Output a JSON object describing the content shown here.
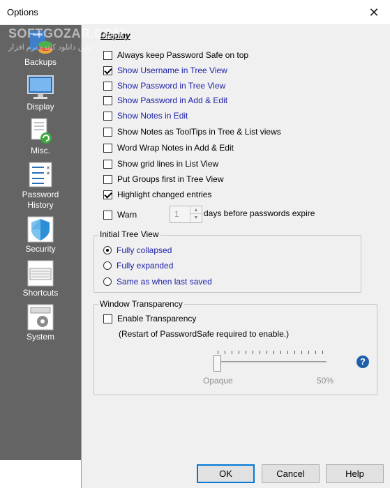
{
  "window": {
    "title": "Options",
    "close_glyph": "✕"
  },
  "watermark": {
    "line1": "SOFTGOZAR.COM",
    "line2": "اولین دانلود کننده نرم افزار"
  },
  "sidebar": {
    "items": [
      {
        "label": "Backups",
        "icon": "backups-icon"
      },
      {
        "label": "Display",
        "icon": "monitor-icon"
      },
      {
        "label": "Misc.",
        "icon": "misc-icon"
      },
      {
        "label": "Password\nHistory",
        "line1": "Password",
        "line2": "History",
        "icon": "password-history-icon"
      },
      {
        "label": "Security",
        "icon": "shield-icon"
      },
      {
        "label": "Shortcuts",
        "icon": "keyboard-icon"
      },
      {
        "label": "System",
        "icon": "system-icon"
      }
    ]
  },
  "display": {
    "section_title": "Display",
    "options": [
      {
        "label": "Always keep Password Safe on top",
        "checked": false
      },
      {
        "label": "Show Username in Tree View",
        "checked": true
      },
      {
        "label": "Show Password in Tree View",
        "checked": false
      },
      {
        "label": "Show Password in Add & Edit",
        "checked": false
      },
      {
        "label": "Show Notes in Edit",
        "checked": false
      },
      {
        "label": "Show Notes as ToolTips in Tree & List views",
        "checked": false
      },
      {
        "label": "Word Wrap Notes in Add & Edit",
        "checked": false
      },
      {
        "label": "Show grid lines in List View",
        "checked": false
      },
      {
        "label": "Put Groups first in Tree View",
        "checked": false
      },
      {
        "label": "Highlight changed entries",
        "checked": true
      }
    ],
    "warn": {
      "label": "Warn",
      "checked": false,
      "value": "1",
      "suffix": "days before passwords expire"
    }
  },
  "initial_tree_view": {
    "title": "Initial Tree View",
    "options": [
      {
        "label": "Fully collapsed",
        "selected": true
      },
      {
        "label": "Fully expanded",
        "selected": false
      },
      {
        "label": "Same as when last saved",
        "selected": false
      }
    ]
  },
  "transparency": {
    "title": "Window Transparency",
    "enable_label": "Enable Transparency",
    "enabled": false,
    "note": "(Restart of PasswordSafe required to enable.)",
    "slider_min_label": "Opaque",
    "slider_max_label": "50%",
    "slider_value": 0,
    "help_glyph": "?"
  },
  "buttons": {
    "ok": "OK",
    "cancel": "Cancel",
    "help": "Help"
  },
  "colors": {
    "sidebar_bg": "#646464",
    "link_blue": "#1e22a8",
    "default_button_border": "#0078d7"
  }
}
